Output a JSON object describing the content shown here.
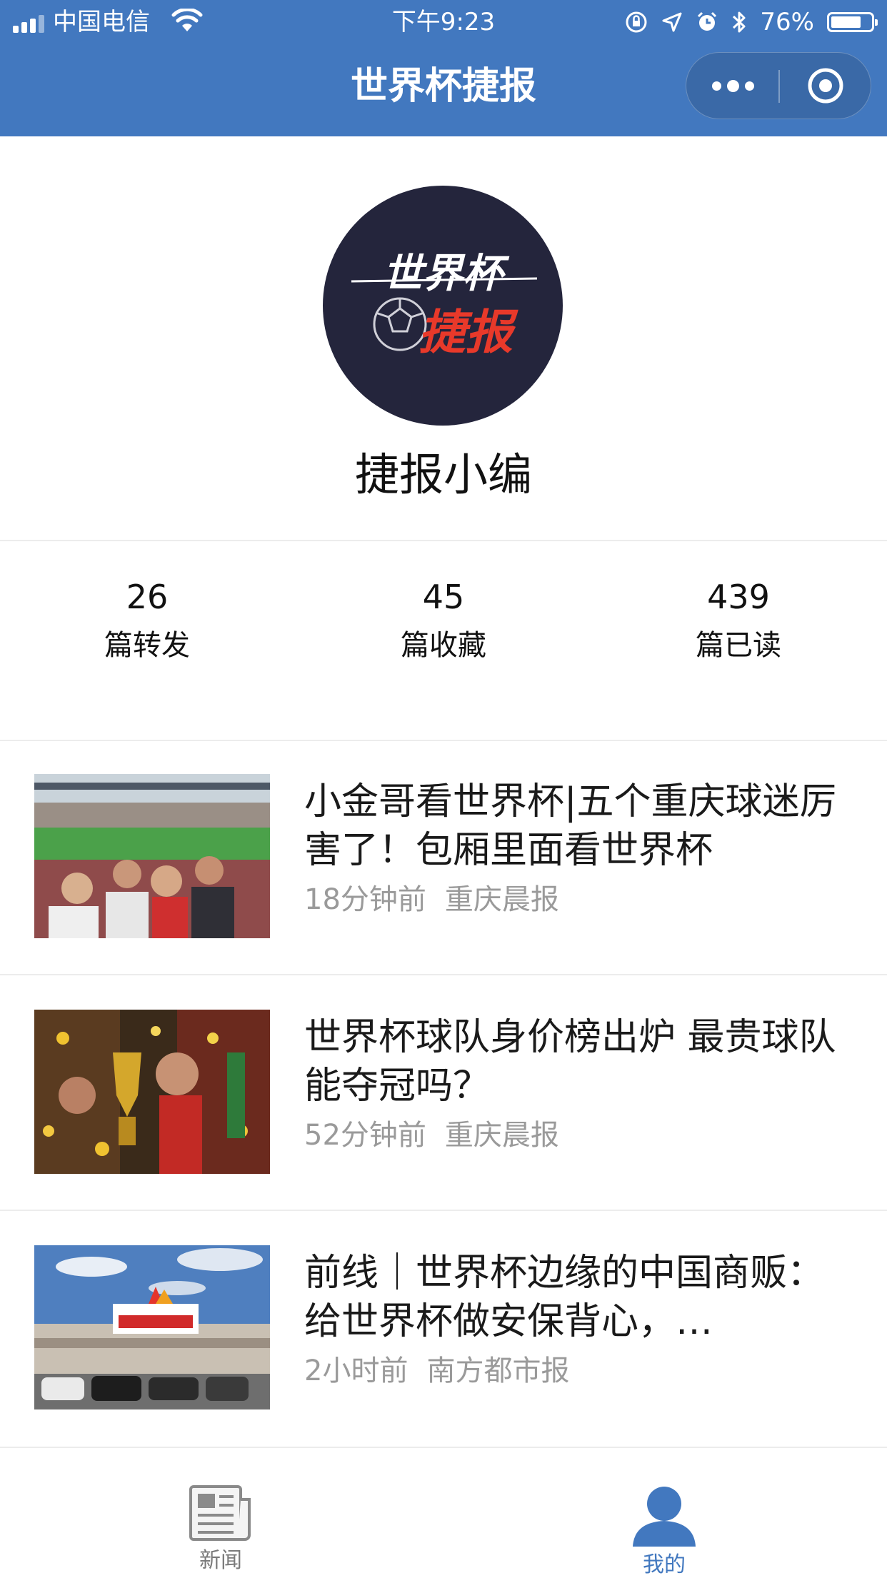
{
  "status_bar": {
    "carrier": "中国电信",
    "time": "下午9:23",
    "battery_percent": "76%",
    "battery_level": 0.76,
    "icons": [
      "signal-icon",
      "wifi-icon",
      "orientation-lock-icon",
      "location-icon",
      "alarm-icon",
      "bluetooth-icon",
      "battery-icon"
    ]
  },
  "nav": {
    "title": "世界杯捷报",
    "capsule": [
      "more-icon",
      "close-miniprogram-icon"
    ]
  },
  "profile": {
    "avatar_logo_line1": "世界杯",
    "avatar_logo_line2": "捷报",
    "name": "捷报小编"
  },
  "stats": [
    {
      "value": "26",
      "label": "篇转发"
    },
    {
      "value": "45",
      "label": "篇收藏"
    },
    {
      "value": "439",
      "label": "篇已读"
    }
  ],
  "news": [
    {
      "title": "小金哥看世界杯|五个重庆球迷厉害了！包厢里面看世界杯",
      "time": "18分钟前",
      "source": "重庆晨报",
      "thumb": "stadium-fans-photo"
    },
    {
      "title": "世界杯球队身价榜出炉 最贵球队能夺冠吗？",
      "time": "52分钟前",
      "source": "重庆晨报",
      "thumb": "trophy-celebration-photo"
    },
    {
      "title": "前线｜世界杯边缘的中国商贩：给世界杯做安保背心，…",
      "time": "2小时前",
      "source": "南方都市报",
      "thumb": "moscow-market-photo"
    }
  ],
  "tabbar": {
    "items": [
      {
        "label": "新闻",
        "icon": "newspaper-icon",
        "active": false
      },
      {
        "label": "我的",
        "icon": "user-icon",
        "active": true
      }
    ],
    "active_color": "#4278bf",
    "inactive_color": "#7a7a7a"
  },
  "colors": {
    "brand": "#4278bf",
    "avatar_bg": "#24253c",
    "logo_red": "#e8392a"
  }
}
